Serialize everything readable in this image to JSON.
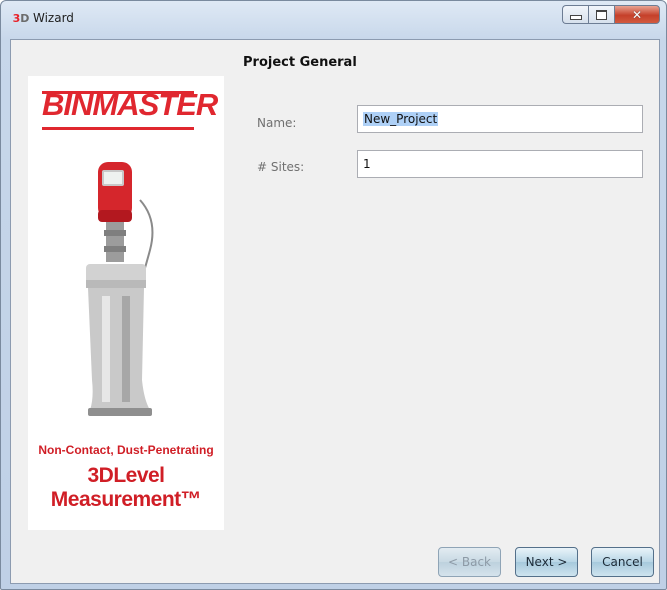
{
  "window": {
    "title": "Wizard",
    "icon": "3d-app-icon",
    "icon_text_a": "3",
    "icon_text_b": "D"
  },
  "page": {
    "heading": "Project General"
  },
  "branding": {
    "logo_text": "BINMASTER",
    "tagline_1": "Non-Contact, Dust-Penetrating",
    "tagline_2": "3DLevel Measurement™",
    "brand_color": "#e0272f"
  },
  "form": {
    "name_label": "Name:",
    "name_value": "New_Project",
    "sites_label": "# Sites:",
    "sites_value": "1"
  },
  "buttons": {
    "back": "< Back",
    "next": "Next >",
    "cancel": "Cancel"
  }
}
